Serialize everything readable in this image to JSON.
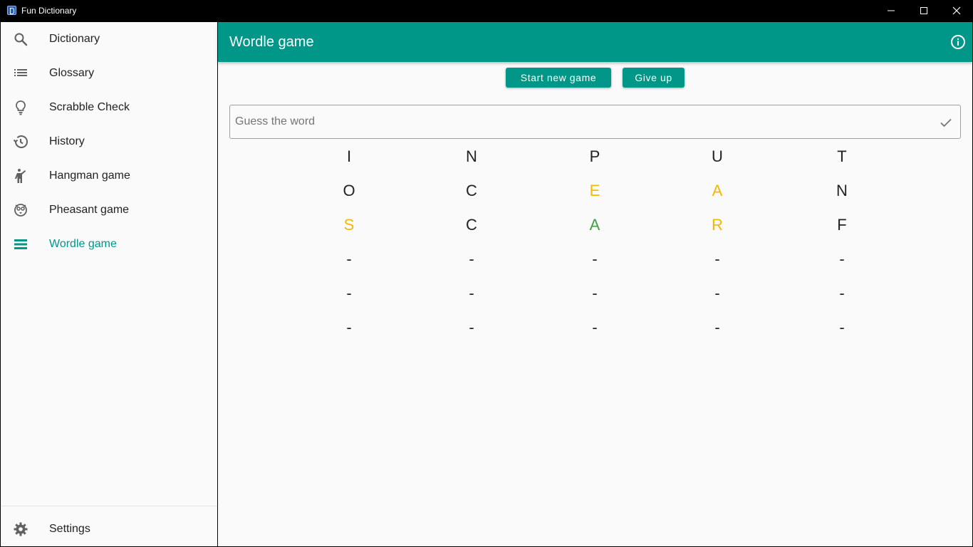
{
  "window": {
    "title": "Fun Dictionary"
  },
  "sidebar": {
    "items": [
      {
        "label": "Dictionary",
        "icon": "search-icon"
      },
      {
        "label": "Glossary",
        "icon": "list-icon"
      },
      {
        "label": "Scrabble Check",
        "icon": "lightbulb-icon"
      },
      {
        "label": "History",
        "icon": "history-icon"
      },
      {
        "label": "Hangman game",
        "icon": "hangman-icon"
      },
      {
        "label": "Pheasant game",
        "icon": "pheasant-icon"
      },
      {
        "label": "Wordle game",
        "icon": "wordle-icon",
        "active": true
      }
    ],
    "settings_label": "Settings"
  },
  "app_bar": {
    "title": "Wordle game",
    "info_icon": "info-icon"
  },
  "actions": {
    "start_label": "Start new game",
    "giveup_label": "Give up"
  },
  "guess": {
    "placeholder": "Guess the word",
    "value": ""
  },
  "colors": {
    "accent": "#009688",
    "present": "#f5b800",
    "correct": "#43a047",
    "absent": "#222222"
  },
  "board": {
    "rows": [
      [
        {
          "letter": "I",
          "state": "absent"
        },
        {
          "letter": "N",
          "state": "absent"
        },
        {
          "letter": "P",
          "state": "absent"
        },
        {
          "letter": "U",
          "state": "absent"
        },
        {
          "letter": "T",
          "state": "absent"
        }
      ],
      [
        {
          "letter": "O",
          "state": "absent"
        },
        {
          "letter": "C",
          "state": "absent"
        },
        {
          "letter": "E",
          "state": "present"
        },
        {
          "letter": "A",
          "state": "present"
        },
        {
          "letter": "N",
          "state": "absent"
        }
      ],
      [
        {
          "letter": "S",
          "state": "present"
        },
        {
          "letter": "C",
          "state": "absent"
        },
        {
          "letter": "A",
          "state": "correct"
        },
        {
          "letter": "R",
          "state": "present"
        },
        {
          "letter": "F",
          "state": "absent"
        }
      ],
      [
        {
          "letter": "-",
          "state": "empty"
        },
        {
          "letter": "-",
          "state": "empty"
        },
        {
          "letter": "-",
          "state": "empty"
        },
        {
          "letter": "-",
          "state": "empty"
        },
        {
          "letter": "-",
          "state": "empty"
        }
      ],
      [
        {
          "letter": "-",
          "state": "empty"
        },
        {
          "letter": "-",
          "state": "empty"
        },
        {
          "letter": "-",
          "state": "empty"
        },
        {
          "letter": "-",
          "state": "empty"
        },
        {
          "letter": "-",
          "state": "empty"
        }
      ],
      [
        {
          "letter": "-",
          "state": "empty"
        },
        {
          "letter": "-",
          "state": "empty"
        },
        {
          "letter": "-",
          "state": "empty"
        },
        {
          "letter": "-",
          "state": "empty"
        },
        {
          "letter": "-",
          "state": "empty"
        }
      ]
    ]
  }
}
